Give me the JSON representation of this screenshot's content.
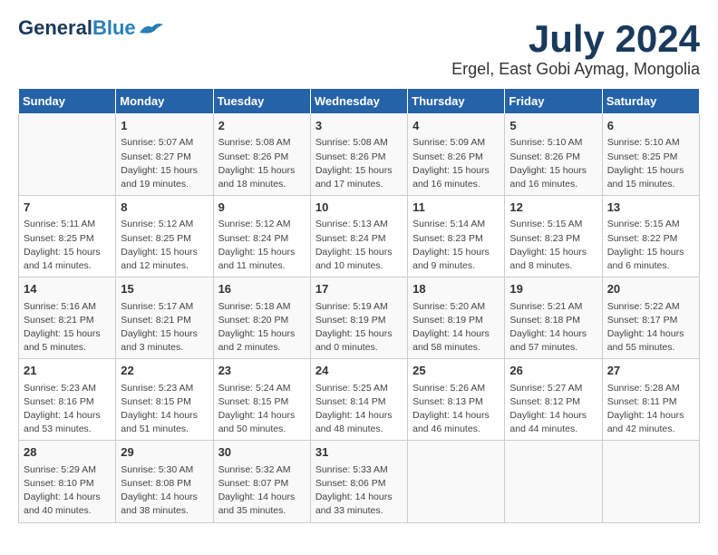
{
  "header": {
    "logo_general": "General",
    "logo_blue": "Blue",
    "month_title": "July 2024",
    "location": "Ergel, East Gobi Aymag, Mongolia"
  },
  "weekdays": [
    "Sunday",
    "Monday",
    "Tuesday",
    "Wednesday",
    "Thursday",
    "Friday",
    "Saturday"
  ],
  "weeks": [
    [
      {
        "day": "",
        "info": ""
      },
      {
        "day": "1",
        "info": "Sunrise: 5:07 AM\nSunset: 8:27 PM\nDaylight: 15 hours\nand 19 minutes."
      },
      {
        "day": "2",
        "info": "Sunrise: 5:08 AM\nSunset: 8:26 PM\nDaylight: 15 hours\nand 18 minutes."
      },
      {
        "day": "3",
        "info": "Sunrise: 5:08 AM\nSunset: 8:26 PM\nDaylight: 15 hours\nand 17 minutes."
      },
      {
        "day": "4",
        "info": "Sunrise: 5:09 AM\nSunset: 8:26 PM\nDaylight: 15 hours\nand 16 minutes."
      },
      {
        "day": "5",
        "info": "Sunrise: 5:10 AM\nSunset: 8:26 PM\nDaylight: 15 hours\nand 16 minutes."
      },
      {
        "day": "6",
        "info": "Sunrise: 5:10 AM\nSunset: 8:25 PM\nDaylight: 15 hours\nand 15 minutes."
      }
    ],
    [
      {
        "day": "7",
        "info": "Sunrise: 5:11 AM\nSunset: 8:25 PM\nDaylight: 15 hours\nand 14 minutes."
      },
      {
        "day": "8",
        "info": "Sunrise: 5:12 AM\nSunset: 8:25 PM\nDaylight: 15 hours\nand 12 minutes."
      },
      {
        "day": "9",
        "info": "Sunrise: 5:12 AM\nSunset: 8:24 PM\nDaylight: 15 hours\nand 11 minutes."
      },
      {
        "day": "10",
        "info": "Sunrise: 5:13 AM\nSunset: 8:24 PM\nDaylight: 15 hours\nand 10 minutes."
      },
      {
        "day": "11",
        "info": "Sunrise: 5:14 AM\nSunset: 8:23 PM\nDaylight: 15 hours\nand 9 minutes."
      },
      {
        "day": "12",
        "info": "Sunrise: 5:15 AM\nSunset: 8:23 PM\nDaylight: 15 hours\nand 8 minutes."
      },
      {
        "day": "13",
        "info": "Sunrise: 5:15 AM\nSunset: 8:22 PM\nDaylight: 15 hours\nand 6 minutes."
      }
    ],
    [
      {
        "day": "14",
        "info": "Sunrise: 5:16 AM\nSunset: 8:21 PM\nDaylight: 15 hours\nand 5 minutes."
      },
      {
        "day": "15",
        "info": "Sunrise: 5:17 AM\nSunset: 8:21 PM\nDaylight: 15 hours\nand 3 minutes."
      },
      {
        "day": "16",
        "info": "Sunrise: 5:18 AM\nSunset: 8:20 PM\nDaylight: 15 hours\nand 2 minutes."
      },
      {
        "day": "17",
        "info": "Sunrise: 5:19 AM\nSunset: 8:19 PM\nDaylight: 15 hours\nand 0 minutes."
      },
      {
        "day": "18",
        "info": "Sunrise: 5:20 AM\nSunset: 8:19 PM\nDaylight: 14 hours\nand 58 minutes."
      },
      {
        "day": "19",
        "info": "Sunrise: 5:21 AM\nSunset: 8:18 PM\nDaylight: 14 hours\nand 57 minutes."
      },
      {
        "day": "20",
        "info": "Sunrise: 5:22 AM\nSunset: 8:17 PM\nDaylight: 14 hours\nand 55 minutes."
      }
    ],
    [
      {
        "day": "21",
        "info": "Sunrise: 5:23 AM\nSunset: 8:16 PM\nDaylight: 14 hours\nand 53 minutes."
      },
      {
        "day": "22",
        "info": "Sunrise: 5:23 AM\nSunset: 8:15 PM\nDaylight: 14 hours\nand 51 minutes."
      },
      {
        "day": "23",
        "info": "Sunrise: 5:24 AM\nSunset: 8:15 PM\nDaylight: 14 hours\nand 50 minutes."
      },
      {
        "day": "24",
        "info": "Sunrise: 5:25 AM\nSunset: 8:14 PM\nDaylight: 14 hours\nand 48 minutes."
      },
      {
        "day": "25",
        "info": "Sunrise: 5:26 AM\nSunset: 8:13 PM\nDaylight: 14 hours\nand 46 minutes."
      },
      {
        "day": "26",
        "info": "Sunrise: 5:27 AM\nSunset: 8:12 PM\nDaylight: 14 hours\nand 44 minutes."
      },
      {
        "day": "27",
        "info": "Sunrise: 5:28 AM\nSunset: 8:11 PM\nDaylight: 14 hours\nand 42 minutes."
      }
    ],
    [
      {
        "day": "28",
        "info": "Sunrise: 5:29 AM\nSunset: 8:10 PM\nDaylight: 14 hours\nand 40 minutes."
      },
      {
        "day": "29",
        "info": "Sunrise: 5:30 AM\nSunset: 8:08 PM\nDaylight: 14 hours\nand 38 minutes."
      },
      {
        "day": "30",
        "info": "Sunrise: 5:32 AM\nSunset: 8:07 PM\nDaylight: 14 hours\nand 35 minutes."
      },
      {
        "day": "31",
        "info": "Sunrise: 5:33 AM\nSunset: 8:06 PM\nDaylight: 14 hours\nand 33 minutes."
      },
      {
        "day": "",
        "info": ""
      },
      {
        "day": "",
        "info": ""
      },
      {
        "day": "",
        "info": ""
      }
    ]
  ]
}
